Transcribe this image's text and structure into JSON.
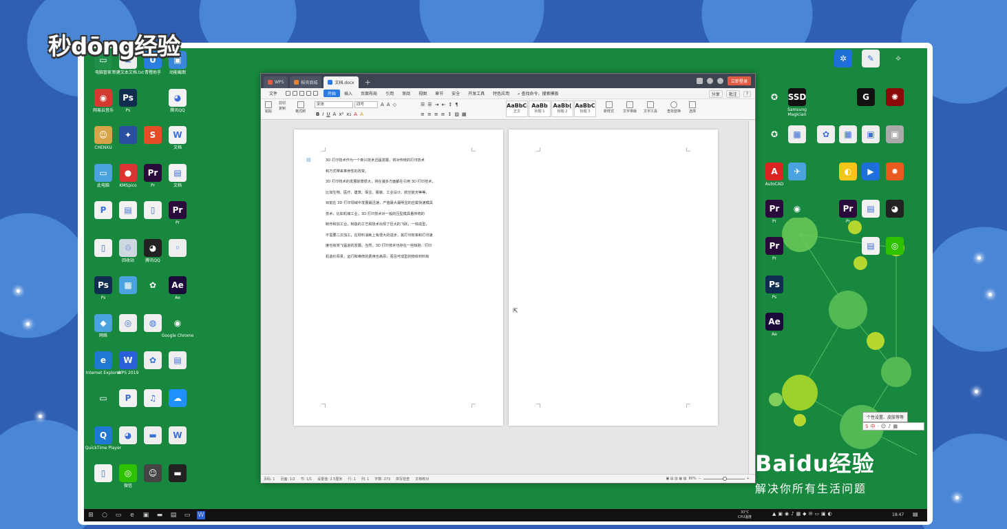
{
  "watermark_left": "秒dōng经验",
  "baidu": {
    "line1": "Baidu经验",
    "line2": "解决你所有生活问题"
  },
  "desktop_icons_left": [
    {
      "label": "电脑管家",
      "color": "#1f8f4a",
      "glyph": "▭"
    },
    {
      "label": "新建文本文档.txt",
      "color": "#eeeeee",
      "glyph": "≡"
    },
    {
      "label": "青橙助手",
      "color": "#2a7de1",
      "glyph": "U"
    },
    {
      "label": "动能截图",
      "color": "#3a86d8",
      "glyph": "▣"
    },
    {
      "label": "网易云音乐",
      "color": "#d33a31",
      "glyph": "◉"
    },
    {
      "label": "Ps",
      "color": "#0f2d4e",
      "glyph": "Ps"
    },
    {
      "label": "",
      "color": "#18883f",
      "glyph": ""
    },
    {
      "label": "腾讯QQ",
      "color": "#f2f2f2",
      "glyph": "◕"
    },
    {
      "label": "CHENXU",
      "color": "#d8a44a",
      "glyph": "☺"
    },
    {
      "label": "",
      "color": "#2b4fa0",
      "glyph": "✦"
    },
    {
      "label": "",
      "color": "#e44d26",
      "glyph": "S"
    },
    {
      "label": "文档",
      "color": "#f2f2f2",
      "glyph": "W"
    },
    {
      "label": "此电脑",
      "color": "#4aa3df",
      "glyph": "▭"
    },
    {
      "label": "KMSpico",
      "color": "#d33",
      "glyph": "●"
    },
    {
      "label": "Pr",
      "color": "#2a0a3a",
      "glyph": "Pr"
    },
    {
      "label": "文档",
      "color": "#f2f2f2",
      "glyph": "▤"
    },
    {
      "label": "",
      "color": "#f2f2f2",
      "glyph": "P"
    },
    {
      "label": "",
      "color": "#f2f2f2",
      "glyph": "▤"
    },
    {
      "label": "",
      "color": "#f2f2f2",
      "glyph": "▯"
    },
    {
      "label": "Pr",
      "color": "#2a0a3a",
      "glyph": "Pr"
    },
    {
      "label": "",
      "color": "#f2f2f2",
      "glyph": "▯"
    },
    {
      "label": "回收站",
      "color": "#cfd8e0",
      "glyph": "♲"
    },
    {
      "label": "腾讯QQ",
      "color": "#222",
      "glyph": "◕"
    },
    {
      "label": "",
      "color": "#eeeeee",
      "glyph": "◦"
    },
    {
      "label": "Ps",
      "color": "#0f2d4e",
      "glyph": "Ps"
    },
    {
      "label": "",
      "color": "#4aa3df",
      "glyph": "▦"
    },
    {
      "label": "",
      "color": "#18883f",
      "glyph": "✿"
    },
    {
      "label": "Ae",
      "color": "#1a0a3a",
      "glyph": "Ae"
    },
    {
      "label": "网络",
      "color": "#4aa3df",
      "glyph": "◆"
    },
    {
      "label": "",
      "color": "#eeeeee",
      "glyph": "◎"
    },
    {
      "label": "",
      "color": "#eeeeee",
      "glyph": "◍"
    },
    {
      "label": "Google Chrome",
      "color": "#18883f",
      "glyph": "◉"
    },
    {
      "label": "Internet Explorer",
      "color": "#1f78d1",
      "glyph": "e"
    },
    {
      "label": "WPS 2019",
      "color": "#2a5fd8",
      "glyph": "W"
    },
    {
      "label": "",
      "color": "#eeeeee",
      "glyph": "✿"
    },
    {
      "label": "",
      "color": "#eeeeee",
      "glyph": "▤"
    },
    {
      "label": "",
      "color": "#18883f",
      "glyph": "▭"
    },
    {
      "label": "",
      "color": "#f2f2f2",
      "glyph": "P"
    },
    {
      "label": "",
      "color": "#f2f2f2",
      "glyph": "♫"
    },
    {
      "label": "",
      "color": "#1e90ff",
      "glyph": "☁"
    },
    {
      "label": "QuickTime Player",
      "color": "#1f78d1",
      "glyph": "Q"
    },
    {
      "label": "",
      "color": "#eeeeee",
      "glyph": "◕"
    },
    {
      "label": "",
      "color": "#eeeeee",
      "glyph": "▬"
    },
    {
      "label": "",
      "color": "#eeeeee",
      "glyph": "W"
    },
    {
      "label": "",
      "color": "#f2f2f2",
      "glyph": "▯"
    },
    {
      "label": "微信",
      "color": "#2dc100",
      "glyph": "◎"
    },
    {
      "label": "",
      "color": "#444",
      "glyph": "☺"
    },
    {
      "label": "",
      "color": "#222",
      "glyph": "▬"
    }
  ],
  "desktop_icons_right": [
    {
      "label": "",
      "color": "#1e6fd8",
      "glyph": "✲"
    },
    {
      "label": "",
      "color": "#eeeeee",
      "glyph": "✎"
    },
    {
      "label": "",
      "color": "#18883f",
      "glyph": "✧"
    },
    {
      "label": "",
      "color": "#18883f",
      "glyph": "✪"
    },
    {
      "label": "Samsung Magician",
      "color": "#111",
      "glyph": "SSD"
    },
    {
      "label": "",
      "color": "#111",
      "glyph": "G"
    },
    {
      "label": "",
      "color": "#8b0a0a",
      "glyph": "✺"
    },
    {
      "label": "",
      "color": "#18883f",
      "glyph": "✪"
    },
    {
      "label": "",
      "color": "#eeeeee",
      "glyph": "▦"
    },
    {
      "label": "",
      "color": "#eeeeee",
      "glyph": "✿"
    },
    {
      "label": "",
      "color": "#eeeeee",
      "glyph": "▦"
    },
    {
      "label": "",
      "color": "#eeeeee",
      "glyph": "▣"
    },
    {
      "label": "",
      "color": "#aaa",
      "glyph": "▣"
    },
    {
      "label": "AutoCAD",
      "color": "#d22",
      "glyph": "A"
    },
    {
      "label": "",
      "color": "#4aa3df",
      "glyph": "✈"
    },
    {
      "label": "",
      "color": "#f5c518",
      "glyph": "◐"
    },
    {
      "label": "",
      "color": "#1e6fd8",
      "glyph": "▶"
    },
    {
      "label": "",
      "color": "#e85a1e",
      "glyph": "✹"
    },
    {
      "label": "Pr",
      "color": "#2a0a3a",
      "glyph": "Pr"
    },
    {
      "label": "",
      "color": "#18883f",
      "glyph": "◉"
    },
    {
      "label": "Pr",
      "color": "#2a0a3a",
      "glyph": "Pr"
    },
    {
      "label": "",
      "color": "#f2f2f2",
      "glyph": "▤"
    },
    {
      "label": "",
      "color": "#222",
      "glyph": "◕"
    },
    {
      "label": "Pr",
      "color": "#2a0a3a",
      "glyph": "Pr"
    },
    {
      "label": "",
      "color": "#f2f2f2",
      "glyph": "▤"
    },
    {
      "label": "",
      "color": "#2dc100",
      "glyph": "◎"
    },
    {
      "label": "Ps",
      "color": "#0f2d4e",
      "glyph": "Ps"
    },
    {
      "label": "Ae",
      "color": "#1a0a3a",
      "glyph": "Ae"
    }
  ],
  "window": {
    "tabs": [
      {
        "label": "WPS",
        "color": "#e25b45"
      },
      {
        "label": "稻壳商城",
        "color": "#e2833a"
      },
      {
        "label": "文档.docx",
        "color": "#2a7ae2"
      }
    ],
    "login_label": "立即登录",
    "menus": [
      "文件",
      "开始",
      "插入",
      "页面布局",
      "引用",
      "审阅",
      "视图",
      "章节",
      "安全",
      "开发工具",
      "特色应用"
    ],
    "active_menu": "开始",
    "search_cmd": "查找命令、搜索模板",
    "share": "分享",
    "review": "批注",
    "ribbon": {
      "paste": "粘贴",
      "cut": "剪切",
      "copy": "复制",
      "format_painter": "格式刷",
      "font_name": "宋体",
      "font_size": "四号",
      "styles": [
        {
          "preview": "AaBbCcDd",
          "name": "正文"
        },
        {
          "preview": "AaBb",
          "name": "标题 1"
        },
        {
          "preview": "AaBb(",
          "name": "标题 2"
        },
        {
          "preview": "AaBbC",
          "name": "标题 3"
        }
      ],
      "new_style": "新样式",
      "text_tools": "文字工具",
      "find_replace": "查找替换",
      "select": "选择",
      "text_layout": "文字排版"
    },
    "doc_lines": [
      "3D 打印技术作为一个新兴技术迅猛发展，将对传统的打印技术",
      "和方式带来革命性的改变。",
      "3D 打印技术的发展前景很大，将在诸多方面都在引用 3D 打印技术，",
      "比如生物、医疗、建筑、珠宝、服装、工业设计、航空航天等等。",
      "目前在 3D 打印领域中发展最迅速，产值最大最明显的应属快速模具",
      "技术，比如机械工业。3D 打印技术对一般的压型模具看传统的",
      "制作和加工业，制造的工艺和技术出现了巨大的飞跃，一体成型，",
      "不需要二次加工，在材料消耗上有很大的进步，其打印效率和打印速",
      "度也有突飞猛进的发展。当然，3D 打印技术也存在一些缺陷：打印",
      "机造价昂贵，运行和维修的费用也高昂，而且可成型的物体材料有"
    ],
    "status": {
      "page_no": "页码: 1",
      "pages": "页面: 1/2",
      "section": "节: 1/1",
      "setting": "设置值: 2.5厘米",
      "row": "行: 1",
      "col": "列: 1",
      "words": "字数: 273",
      "spell": "拼写检查",
      "doc_check": "文档校对",
      "zoom": "80%"
    }
  },
  "tooltip": "个性设置、皮肤等等",
  "ime_text": "中",
  "taskbar": {
    "weather": "30°C",
    "weather2": "CPU温度",
    "time": "18:47"
  }
}
